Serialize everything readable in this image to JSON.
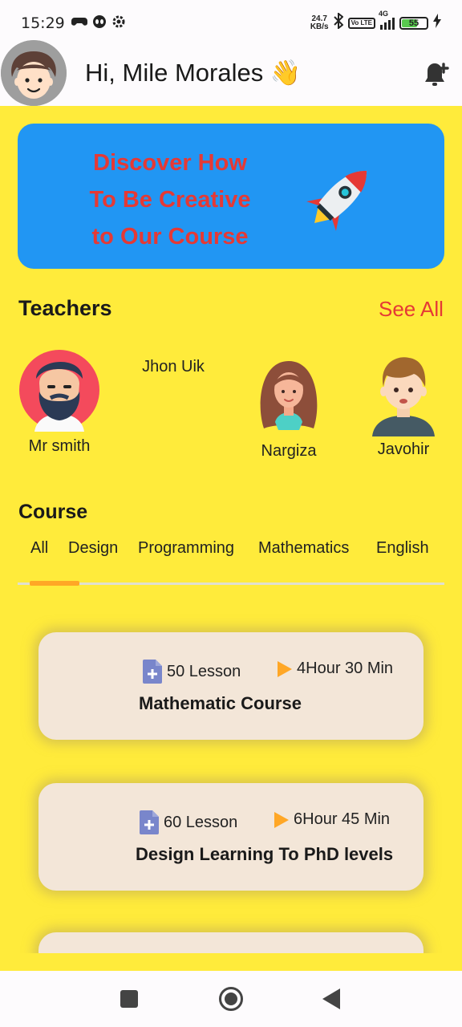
{
  "status_bar": {
    "time": "15:29",
    "net_speed_value": "24.7",
    "net_speed_unit": "KB/s",
    "volte": "Vo LTE",
    "network": "4G",
    "battery": "55"
  },
  "header": {
    "greeting": "Hi, Mile Morales 👋"
  },
  "banner": {
    "line1": "Discover How",
    "line2": "To Be Creative",
    "line3": "to Our Course"
  },
  "teachers": {
    "title": "Teachers",
    "see_all": "See All",
    "items": [
      {
        "name": "Mr smith"
      },
      {
        "name": "Jhon Uik"
      },
      {
        "name": "Nargiza"
      },
      {
        "name": "Javohir"
      }
    ]
  },
  "course": {
    "title": "Course",
    "tabs": [
      "All",
      "Design",
      "Programming",
      "Mathematics",
      "English"
    ],
    "selected_tab": "All",
    "accent": "#ffa726",
    "cards": [
      {
        "lessons": "50 Lesson",
        "duration": "4Hour 30 Min",
        "title": "Mathematic Course"
      },
      {
        "lessons": "60 Lesson",
        "duration": "6Hour 45 Min",
        "title": "Design Learning To PhD levels"
      }
    ]
  },
  "colors": {
    "background": "#ffeb3b",
    "banner": "#2196f3",
    "banner_text": "#e53935",
    "card": "#f3e6d8"
  },
  "icons": {
    "status": [
      "game-controller-icon",
      "alien-icon",
      "settings-gear-icon",
      "bluetooth-icon",
      "signal-icon",
      "battery-icon",
      "charging-icon"
    ],
    "header": [
      "avatar",
      "bell-plus-icon"
    ],
    "card": [
      "document-plus-icon",
      "play-triangle-icon"
    ],
    "nav": [
      "square-recents-icon",
      "circle-home-icon",
      "triangle-back-icon"
    ]
  }
}
